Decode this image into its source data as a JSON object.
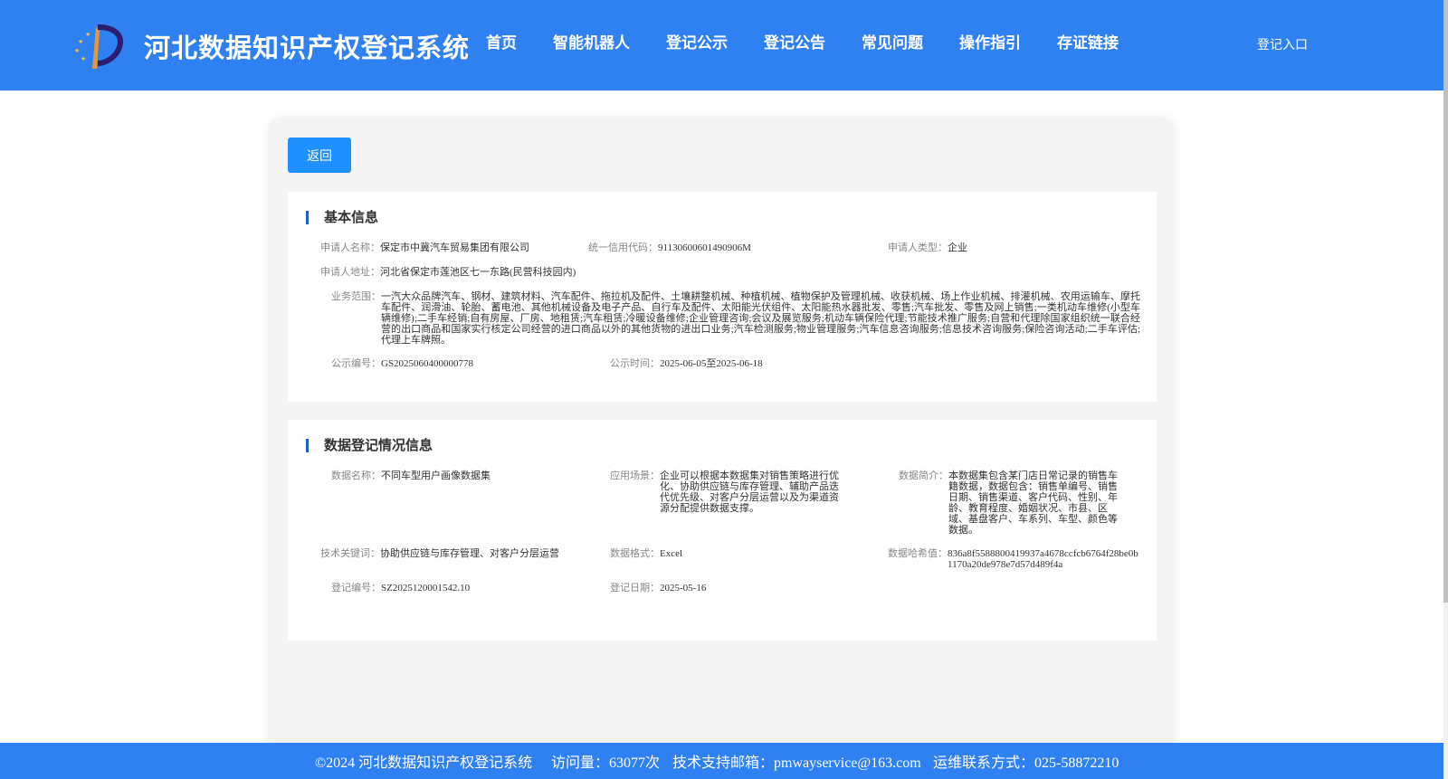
{
  "header": {
    "logo_icon": "star-and-p-logo",
    "site_title": "河北数据知识产权登记系统",
    "nav": [
      "首页",
      "智能机器人",
      "登记公示",
      "登记公告",
      "常见问题",
      "操作指引",
      "存证链接"
    ],
    "login_link": "登记入口",
    "colors": {
      "header_bg": "#2f80f0",
      "accent": "#1e90ff",
      "section_bar": "#1e5fc8"
    }
  },
  "back_button": "返回",
  "basic_info": {
    "title": "基本信息",
    "applicant_name_label": "申请人名称：",
    "applicant_name": "保定市中冀汽车贸易集团有限公司",
    "credit_code_label": "统一信用代码：",
    "credit_code": "91130600601490906M",
    "applicant_type_label": "申请人类型：",
    "applicant_type": "企业",
    "address_label": "申请人地址：",
    "address": "河北省保定市莲池区七一东路(民营科技园内)",
    "scope_label": "业务范围：",
    "scope": "一汽大众品牌汽车、钢材、建筑材料、汽车配件、拖拉机及配件、土壤耕整机械、种植机械、植物保护及管理机械、收获机械、场上作业机械、排灌机械、农用运输车、摩托车配件、润滑油、轮胎、蓄电池、其他机械设备及电子产品、自行车及配件、太阳能光伏组件、太阳能热水器批发、零售;汽车批发、零售及网上销售;一类机动车维修(小型车辆维修);二手车经销;自有房屋、厂房、地租赁;汽车租赁;冷暖设备维修;企业管理咨询;会议及展览服务;机动车辆保险代理;节能技术推广服务;自营和代理除国家组织统一联合经营的出口商品和国家实行核定公司经营的进口商品以外的其他货物的进出口业务;汽车检测服务;物业管理服务;汽车信息咨询服务;信息技术咨询服务;保险咨询活动;二手车评估;代理上车牌照。",
    "notice_no_label": "公示编号：",
    "notice_no": "GS2025060400000778",
    "notice_time_label": "公示时间：",
    "notice_time": "2025-06-05至2025-06-18"
  },
  "data_info": {
    "title": "数据登记情况信息",
    "data_name_label": "数据名称：",
    "data_name": "不同车型用户画像数据集",
    "scene_label": "应用场景：",
    "scene": "企业可以根据本数据集对销售策略进行优化、协助供应链与库存管理、辅助产品迭代优先级、对客户分层运营以及为渠道资源分配提供数据支撑。",
    "intro_label": "数据简介：",
    "intro": "本数据集包含某门店日常记录的销售车籍数据，数据包含：销售单编号、销售日期、销售渠道、客户代码、性别、年龄、教育程度、婚姻状况、市县、区域、基盘客户、车系列、车型、颜色等数据。",
    "keywords_label": "技术关键词：",
    "keywords": "协助供应链与库存管理、对客户分层运营",
    "format_label": "数据格式：",
    "format": "Excel",
    "hash_label": "数据哈希值：",
    "hash": "836a8f5588800419937a4678ccfcb6764f28be0b1170a20de978e7d57d489f4a",
    "reg_no_label": "登记编号：",
    "reg_no": "SZ2025120001542.10",
    "reg_date_label": "登记日期：",
    "reg_date": "2025-05-16"
  },
  "footer": {
    "copyright": "©2024 河北数据知识产权登记系统",
    "visits": "访问量：63077次",
    "email": "技术支持邮箱：pmwayservice@163.com",
    "phone": "运维联系方式：025-58872210"
  }
}
